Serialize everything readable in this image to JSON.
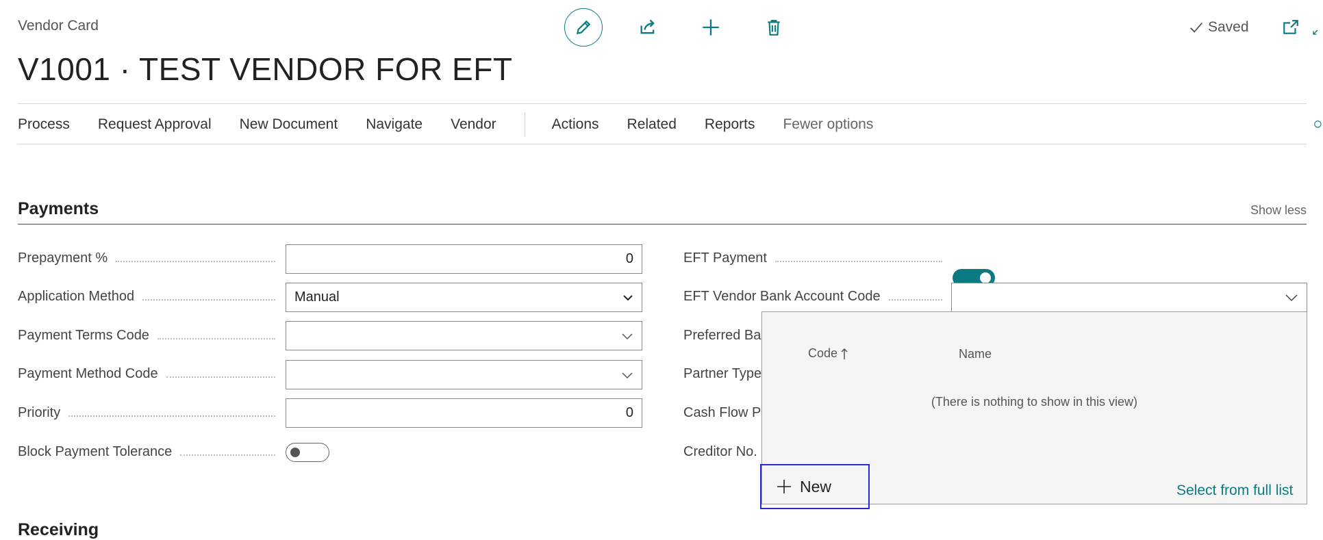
{
  "page": {
    "caption": "Vendor Card",
    "title": "V1001 · TEST VENDOR FOR EFT",
    "status": "Saved"
  },
  "toolbar": {
    "icons": [
      "edit-icon",
      "share-icon",
      "add-icon",
      "delete-icon",
      "open-new-window-icon",
      "collapse-icon",
      "search-icon"
    ]
  },
  "menu": {
    "items": [
      "Process",
      "Request Approval",
      "New Document",
      "Navigate",
      "Vendor"
    ],
    "items2": [
      "Actions",
      "Related",
      "Reports"
    ],
    "fewer": "Fewer options"
  },
  "payments": {
    "title": "Payments",
    "show_less": "Show less",
    "fields_left": [
      {
        "label": "Prepayment %",
        "value": "0"
      },
      {
        "label": "Application Method",
        "value": "Manual"
      },
      {
        "label": "Payment Terms Code",
        "value": ""
      },
      {
        "label": "Payment Method Code",
        "value": ""
      },
      {
        "label": "Priority",
        "value": "0"
      },
      {
        "label": "Block Payment Tolerance",
        "value": false
      }
    ],
    "fields_right": [
      {
        "label": "EFT Payment",
        "value": true
      },
      {
        "label": "EFT Vendor Bank Account Code",
        "value": ""
      },
      {
        "label": "Preferred Ba"
      },
      {
        "label": "Partner Type"
      },
      {
        "label": "Cash Flow Pa"
      },
      {
        "label": "Creditor No."
      }
    ]
  },
  "lookup": {
    "columns": [
      "Code",
      "Name"
    ],
    "empty_text": "(There is nothing to show in this view)",
    "new_label": "New",
    "full_list_label": "Select from full list"
  },
  "next_section": "Receiving",
  "colors": {
    "accent": "#0c7a83",
    "focus": "#2a2ad0"
  }
}
